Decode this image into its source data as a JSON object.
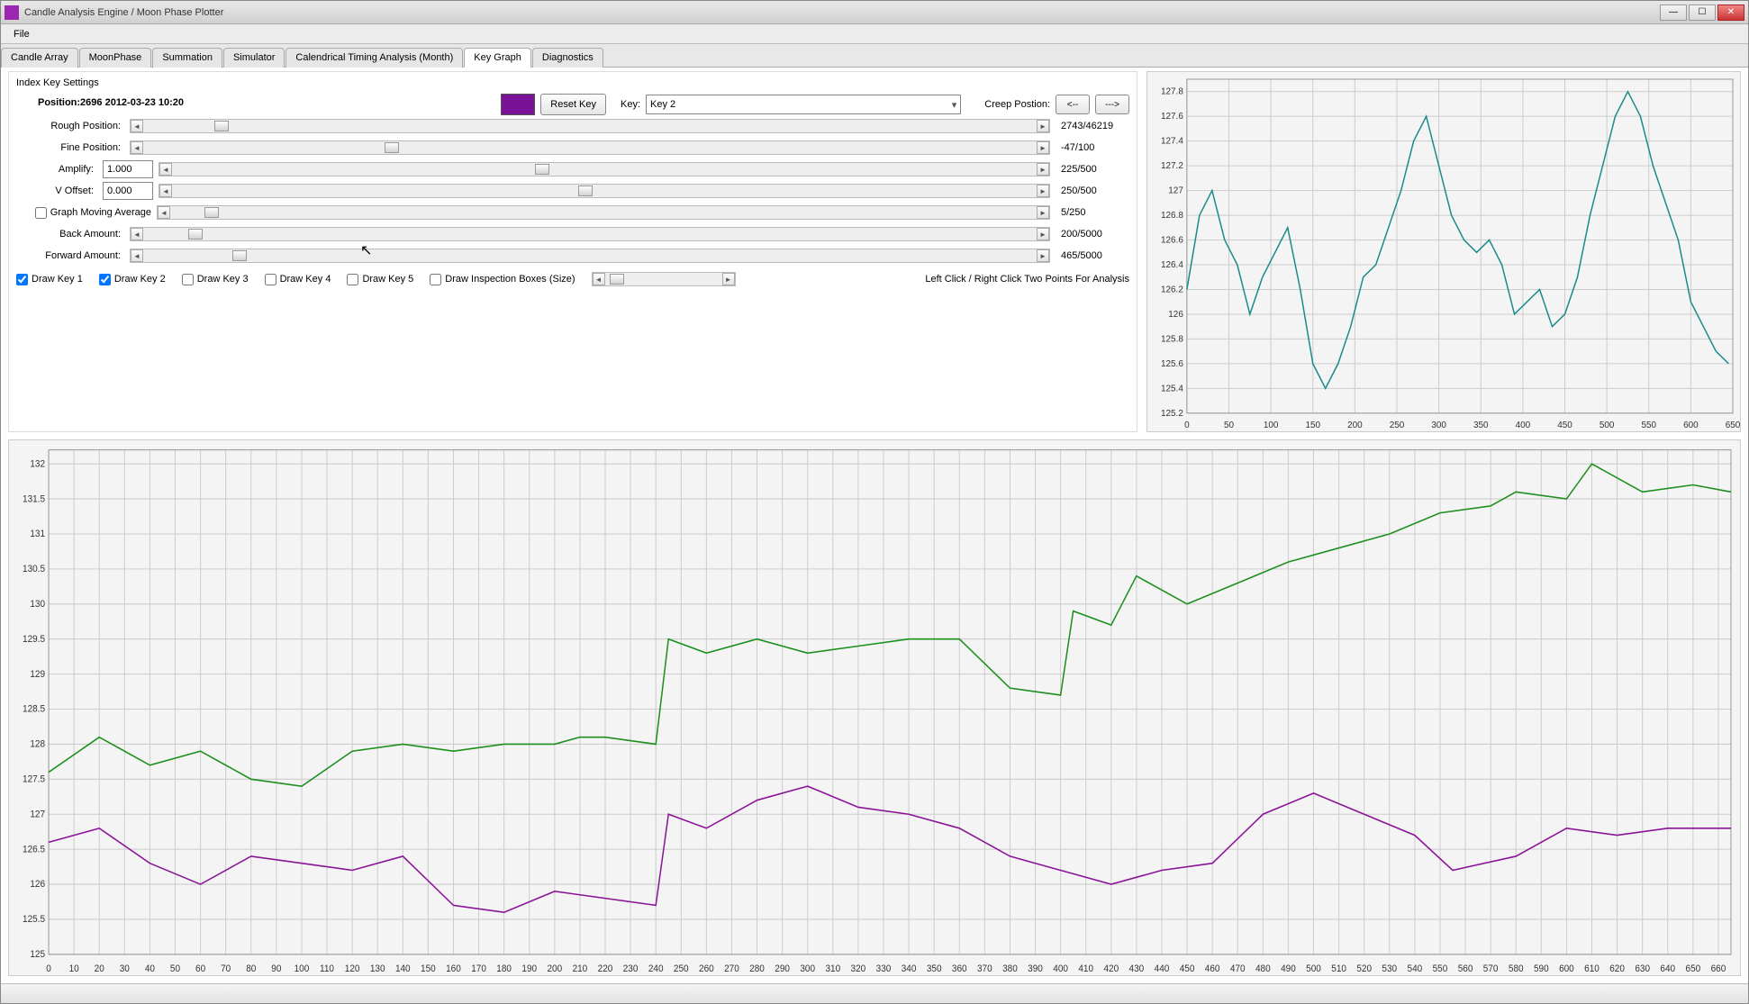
{
  "window": {
    "title": "Candle Analysis Engine / Moon Phase Plotter"
  },
  "menu": {
    "file": "File"
  },
  "tabs": {
    "items": [
      "Candle Array",
      "MoonPhase",
      "Summation",
      "Simulator",
      "Calendrical Timing Analysis (Month)",
      "Key Graph",
      "Diagnostics"
    ],
    "active_index": 5
  },
  "settings": {
    "panel_title": "Index Key Settings",
    "position_label": "Position:2696 2012-03-23 10:20",
    "reset_key": "Reset Key",
    "key_label": "Key:",
    "key_value": "Key 2",
    "creep_label": "Creep Postion:",
    "creep_back": "<--",
    "creep_forward": "--->",
    "color_hex": "#7a1297",
    "rows": {
      "rough": {
        "label": "Rough Position:",
        "thumb_pct": 8,
        "value": "2743/46219"
      },
      "fine": {
        "label": "Fine Position:",
        "thumb_pct": 27,
        "value": "-47/100"
      },
      "amplify": {
        "label": "Amplify:",
        "input": "1.000",
        "thumb_pct": 42,
        "value": "225/500"
      },
      "voffset": {
        "label": "V Offset:",
        "input": "0.000",
        "thumb_pct": 47,
        "value": "250/500"
      },
      "gma": {
        "label": "Graph Moving Average",
        "checked": false,
        "thumb_pct": 4,
        "value": "5/250"
      },
      "back": {
        "label": "Back Amount:",
        "thumb_pct": 5,
        "value": "200/5000"
      },
      "fwd": {
        "label": "Forward Amount:",
        "thumb_pct": 10,
        "value": "465/5000"
      }
    },
    "draw_keys": [
      {
        "label": "Draw Key 1",
        "checked": true
      },
      {
        "label": "Draw Key 2",
        "checked": true
      },
      {
        "label": "Draw Key 3",
        "checked": false
      },
      {
        "label": "Draw Key 4",
        "checked": false
      },
      {
        "label": "Draw Key 5",
        "checked": false
      },
      {
        "label": "Draw Inspection Boxes (Size)",
        "checked": false
      }
    ],
    "analysis_hint": "Left Click / Right Click Two Points For Analysis"
  },
  "chart_data": [
    {
      "id": "small_chart",
      "type": "line",
      "xlabel": "",
      "ylabel": "",
      "xlim": [
        0,
        650
      ],
      "ylim": [
        125.2,
        127.9
      ],
      "x_ticks": [
        0,
        50,
        100,
        150,
        200,
        250,
        300,
        350,
        400,
        450,
        500,
        550,
        600,
        650
      ],
      "y_ticks": [
        125.2,
        125.4,
        125.6,
        125.8,
        126.0,
        126.2,
        126.4,
        126.6,
        126.8,
        127.0,
        127.2,
        127.4,
        127.6,
        127.8
      ],
      "series": [
        {
          "name": "teal",
          "color": "#1a8a8a",
          "x": [
            0,
            15,
            30,
            45,
            60,
            75,
            90,
            105,
            120,
            135,
            150,
            165,
            180,
            195,
            210,
            225,
            240,
            255,
            270,
            285,
            300,
            315,
            330,
            345,
            360,
            375,
            390,
            405,
            420,
            435,
            450,
            465,
            480,
            495,
            510,
            525,
            540,
            555,
            570,
            585,
            600,
            615,
            630,
            645
          ],
          "values": [
            126.2,
            126.8,
            127.0,
            126.6,
            126.4,
            126.0,
            126.3,
            126.5,
            126.7,
            126.2,
            125.6,
            125.4,
            125.6,
            125.9,
            126.3,
            126.4,
            126.7,
            127.0,
            127.4,
            127.6,
            127.2,
            126.8,
            126.6,
            126.5,
            126.6,
            126.4,
            126.0,
            126.1,
            126.2,
            125.9,
            126.0,
            126.3,
            126.8,
            127.2,
            127.6,
            127.8,
            127.6,
            127.2,
            126.9,
            126.6,
            126.1,
            125.9,
            125.7,
            125.6
          ]
        }
      ]
    },
    {
      "id": "big_chart",
      "type": "line",
      "xlabel": "",
      "ylabel": "",
      "xlim": [
        0,
        665
      ],
      "ylim": [
        125.0,
        132.2
      ],
      "x_ticks": [
        0,
        10,
        20,
        30,
        40,
        50,
        60,
        70,
        80,
        90,
        100,
        110,
        120,
        130,
        140,
        150,
        160,
        170,
        180,
        190,
        200,
        210,
        220,
        230,
        240,
        250,
        260,
        270,
        280,
        290,
        300,
        310,
        320,
        330,
        340,
        350,
        360,
        370,
        380,
        390,
        400,
        410,
        420,
        430,
        440,
        450,
        460,
        470,
        480,
        490,
        500,
        510,
        520,
        530,
        540,
        550,
        560,
        570,
        580,
        590,
        600,
        610,
        620,
        630,
        640,
        650,
        660
      ],
      "y_ticks": [
        125.0,
        125.5,
        126.0,
        126.5,
        127.0,
        127.5,
        128.0,
        128.5,
        129.0,
        129.5,
        130.0,
        130.5,
        131.0,
        131.5,
        132.0
      ],
      "series": [
        {
          "name": "Key 1",
          "color": "#1c8f1c",
          "x": [
            0,
            20,
            40,
            60,
            80,
            100,
            120,
            140,
            160,
            180,
            200,
            210,
            220,
            240,
            245,
            260,
            280,
            300,
            320,
            340,
            360,
            380,
            400,
            405,
            420,
            430,
            450,
            470,
            490,
            510,
            530,
            550,
            570,
            580,
            600,
            610,
            630,
            650,
            665
          ],
          "values": [
            127.6,
            128.1,
            127.7,
            127.9,
            127.5,
            127.4,
            127.9,
            128.0,
            127.9,
            128.0,
            128.0,
            128.1,
            128.1,
            128.0,
            129.5,
            129.3,
            129.5,
            129.3,
            129.4,
            129.5,
            129.5,
            128.8,
            128.7,
            129.9,
            129.7,
            130.4,
            130.0,
            130.3,
            130.6,
            130.8,
            131.0,
            131.3,
            131.4,
            131.6,
            131.5,
            132.0,
            131.6,
            131.7,
            131.6
          ]
        },
        {
          "name": "Key 2",
          "color": "#8a1397",
          "x": [
            0,
            20,
            40,
            60,
            80,
            100,
            120,
            140,
            160,
            180,
            200,
            220,
            240,
            245,
            260,
            280,
            300,
            320,
            340,
            360,
            380,
            400,
            420,
            440,
            460,
            480,
            500,
            520,
            540,
            555,
            580,
            600,
            620,
            640,
            665
          ],
          "values": [
            126.6,
            126.8,
            126.3,
            126.0,
            126.4,
            126.3,
            126.2,
            126.4,
            125.7,
            125.6,
            125.9,
            125.8,
            125.7,
            127.0,
            126.8,
            127.2,
            127.4,
            127.1,
            127.0,
            126.8,
            126.4,
            126.2,
            126.0,
            126.2,
            126.3,
            127.0,
            127.3,
            127.0,
            126.7,
            126.2,
            126.4,
            126.8,
            126.7,
            126.8,
            126.8
          ]
        }
      ]
    }
  ]
}
